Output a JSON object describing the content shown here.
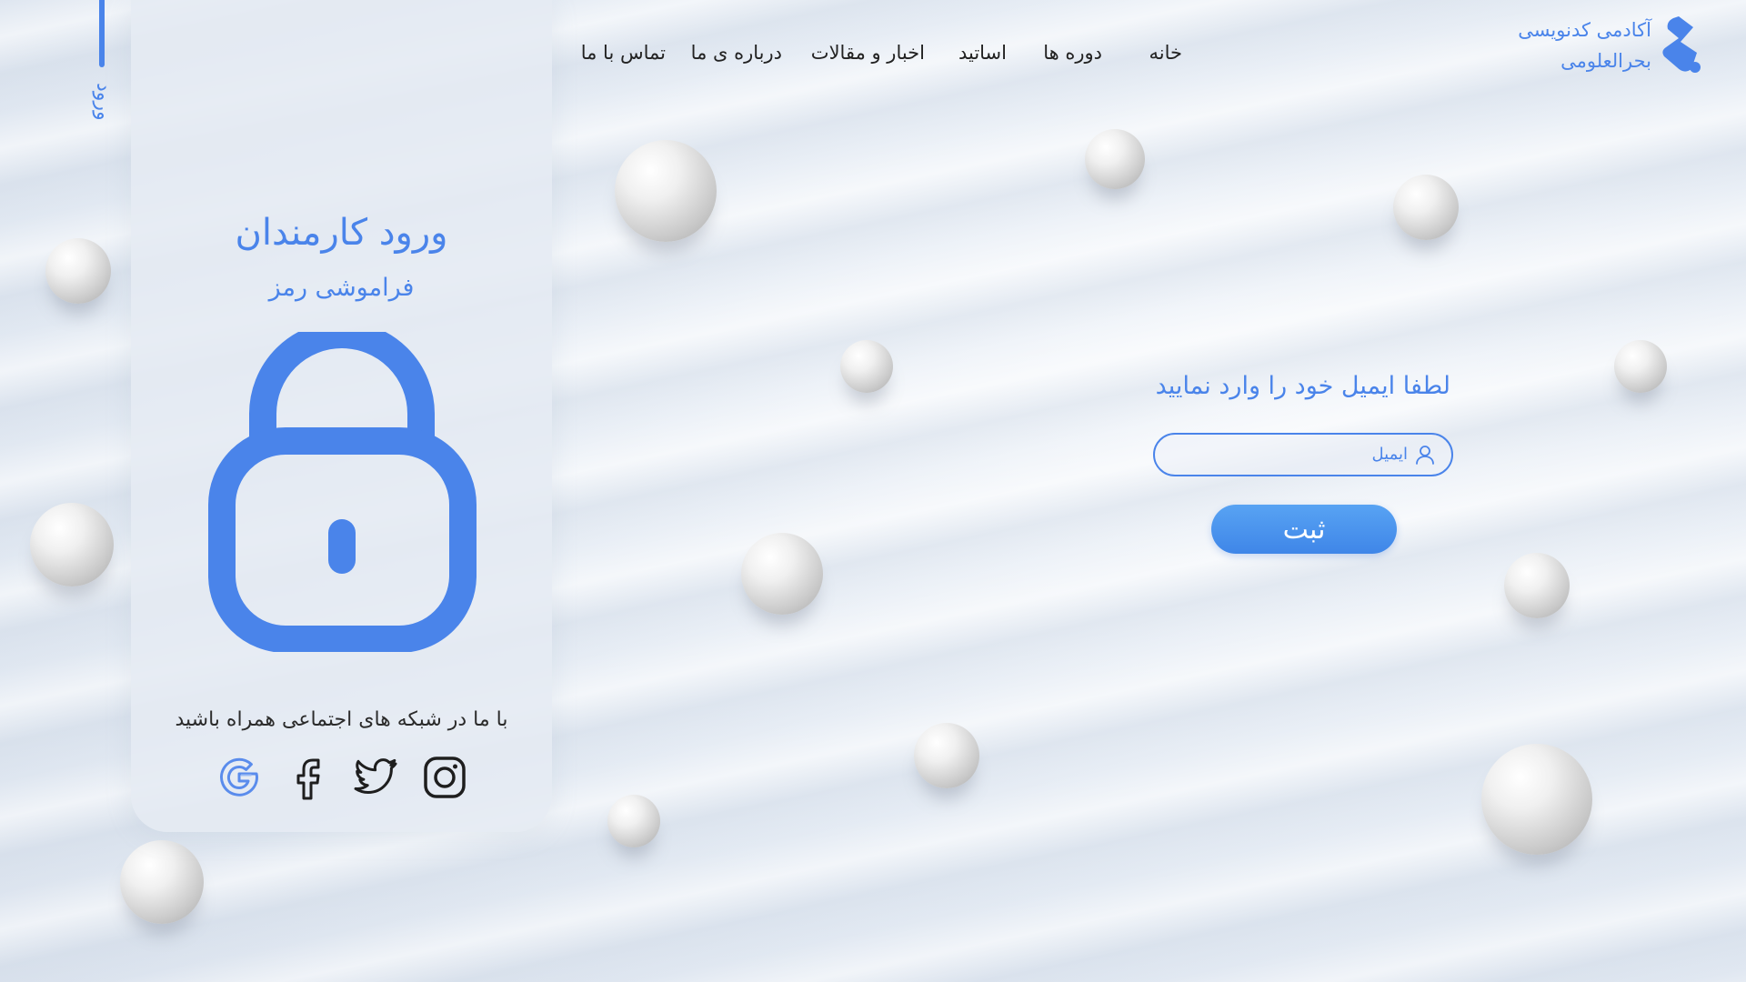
{
  "side": {
    "label": "ورود"
  },
  "panel": {
    "title": "ورود کارمندان",
    "subtitle": "فراموشی رمز",
    "lock_icon": "lock-icon",
    "social_text": "با ما در شبکه های اجتماعی همراه باشید",
    "socials": [
      {
        "name": "instagram-icon"
      },
      {
        "name": "twitter-icon"
      },
      {
        "name": "facebook-icon"
      },
      {
        "name": "google-icon"
      }
    ]
  },
  "nav": {
    "items": [
      {
        "label": "خانه"
      },
      {
        "label": "دوره ها"
      },
      {
        "label": "اساتید"
      },
      {
        "label": "اخبار و مقالات"
      },
      {
        "label": "درباره ی ما"
      },
      {
        "label": "تماس با ما"
      }
    ]
  },
  "brand": {
    "line1": "آکادمی کدنویسی",
    "line2": "بحرالعلومی",
    "logo": "brand-logo-icon"
  },
  "form": {
    "title": "لطفا ایمیل خود را وارد نمایید",
    "email_placeholder": "ایمیل",
    "email_value": "",
    "submit_label": "ثبت"
  },
  "colors": {
    "accent": "#4a84ea",
    "button_top": "#58a3f3",
    "button_bottom": "#3f86e8",
    "text": "#222222"
  }
}
